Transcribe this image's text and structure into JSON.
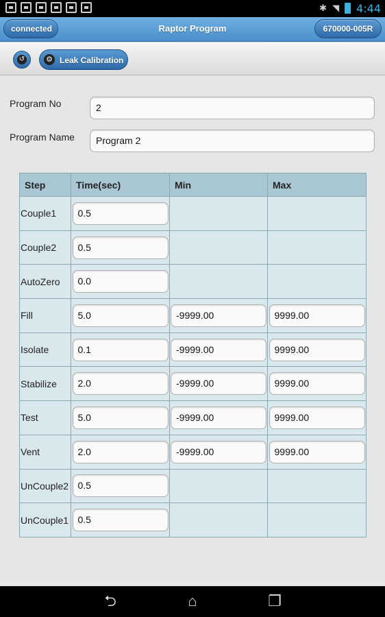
{
  "status_bar": {
    "notification_icons": [
      "download-icon",
      "image-icon",
      "download-icon",
      "briefcase-check-icon",
      "briefcase-check-icon",
      "briefcase-icon"
    ],
    "time": "4:44"
  },
  "header": {
    "connection_status": "connected",
    "title": "Raptor Program",
    "device_id": "670000-005R"
  },
  "toolbar": {
    "back_icon": "back-icon",
    "leak_calibration_label": "Leak Calibration"
  },
  "form": {
    "program_no_label": "Program No",
    "program_no_value": "2",
    "program_name_label": "Program Name",
    "program_name_value": "Program 2"
  },
  "table": {
    "headers": [
      "Step",
      "Time(sec)",
      "Min",
      "Max"
    ],
    "rows": [
      {
        "step": "Couple1",
        "time": "0.5",
        "min": "",
        "max": ""
      },
      {
        "step": "Couple2",
        "time": "0.5",
        "min": "",
        "max": ""
      },
      {
        "step": "AutoZero",
        "time": "0.0",
        "min": "",
        "max": ""
      },
      {
        "step": "Fill",
        "time": "5.0",
        "min": "-9999.00",
        "max": "9999.00"
      },
      {
        "step": "Isolate",
        "time": "0.1",
        "min": "-9999.00",
        "max": "9999.00"
      },
      {
        "step": "Stabilize",
        "time": "2.0",
        "min": "-9999.00",
        "max": "9999.00"
      },
      {
        "step": "Test",
        "time": "5.0",
        "min": "-9999.00",
        "max": "9999.00"
      },
      {
        "step": "Vent",
        "time": "2.0",
        "min": "-9999.00",
        "max": "9999.00"
      },
      {
        "step": "UnCouple2",
        "time": "0.5",
        "min": "",
        "max": ""
      },
      {
        "step": "UnCouple1",
        "time": "0.5",
        "min": "",
        "max": ""
      }
    ]
  },
  "colors": {
    "header_blue": "#4a8fcc",
    "table_header": "#a9c6d3",
    "table_cell": "#d9e8ed",
    "clock": "#33b5e5"
  }
}
